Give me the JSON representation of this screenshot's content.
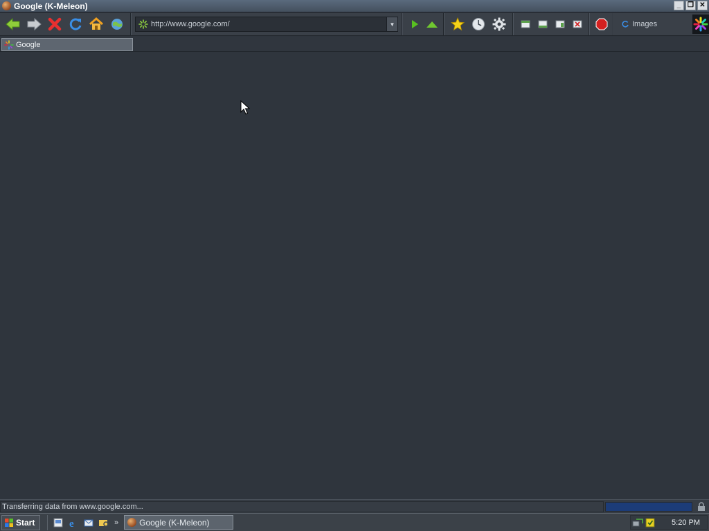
{
  "window": {
    "title": "Google (K-Meleon)",
    "app_icon": "k-meleon-icon",
    "controls": [
      "minimize-icon",
      "restore-icon",
      "close-icon"
    ]
  },
  "toolbar": {
    "nav_buttons": [
      "back-icon",
      "forward-icon",
      "stop-icon",
      "reload-icon",
      "home-icon",
      "globe-icon"
    ],
    "url": {
      "value": "http://www.google.com/",
      "loading_icon": "loading-spinner-icon"
    },
    "go_buttons": [
      "go-icon",
      "up-icon"
    ],
    "tool_buttons": [
      "bookmarks-star-icon",
      "history-clock-icon",
      "settings-gear-icon"
    ],
    "window_buttons": [
      "layer-prev-icon",
      "layer-next-icon",
      "new-layer-icon",
      "close-layer-icon"
    ],
    "adblock_label": "ABP",
    "images_label": "Images"
  },
  "tabs": [
    {
      "label": "Google",
      "icon": "loading-tab-icon",
      "active": true
    }
  ],
  "status": {
    "text": "Transferring data from www.google.com...",
    "progress": 1.0
  },
  "taskbar": {
    "start_label": "Start",
    "quick_launch": [
      "desktop-icon",
      "ie-icon",
      "outlook-icon",
      "explorer-icon"
    ],
    "overflow": "»",
    "task_button_label": "Google (K-Meleon)",
    "tray_icons": [
      "network-icon",
      "antivirus-icon"
    ],
    "clock": "5:20 PM"
  },
  "colors": {
    "background": "#2f353d",
    "progress": "#1c3c78",
    "titlebar": "#4d5a6a"
  }
}
